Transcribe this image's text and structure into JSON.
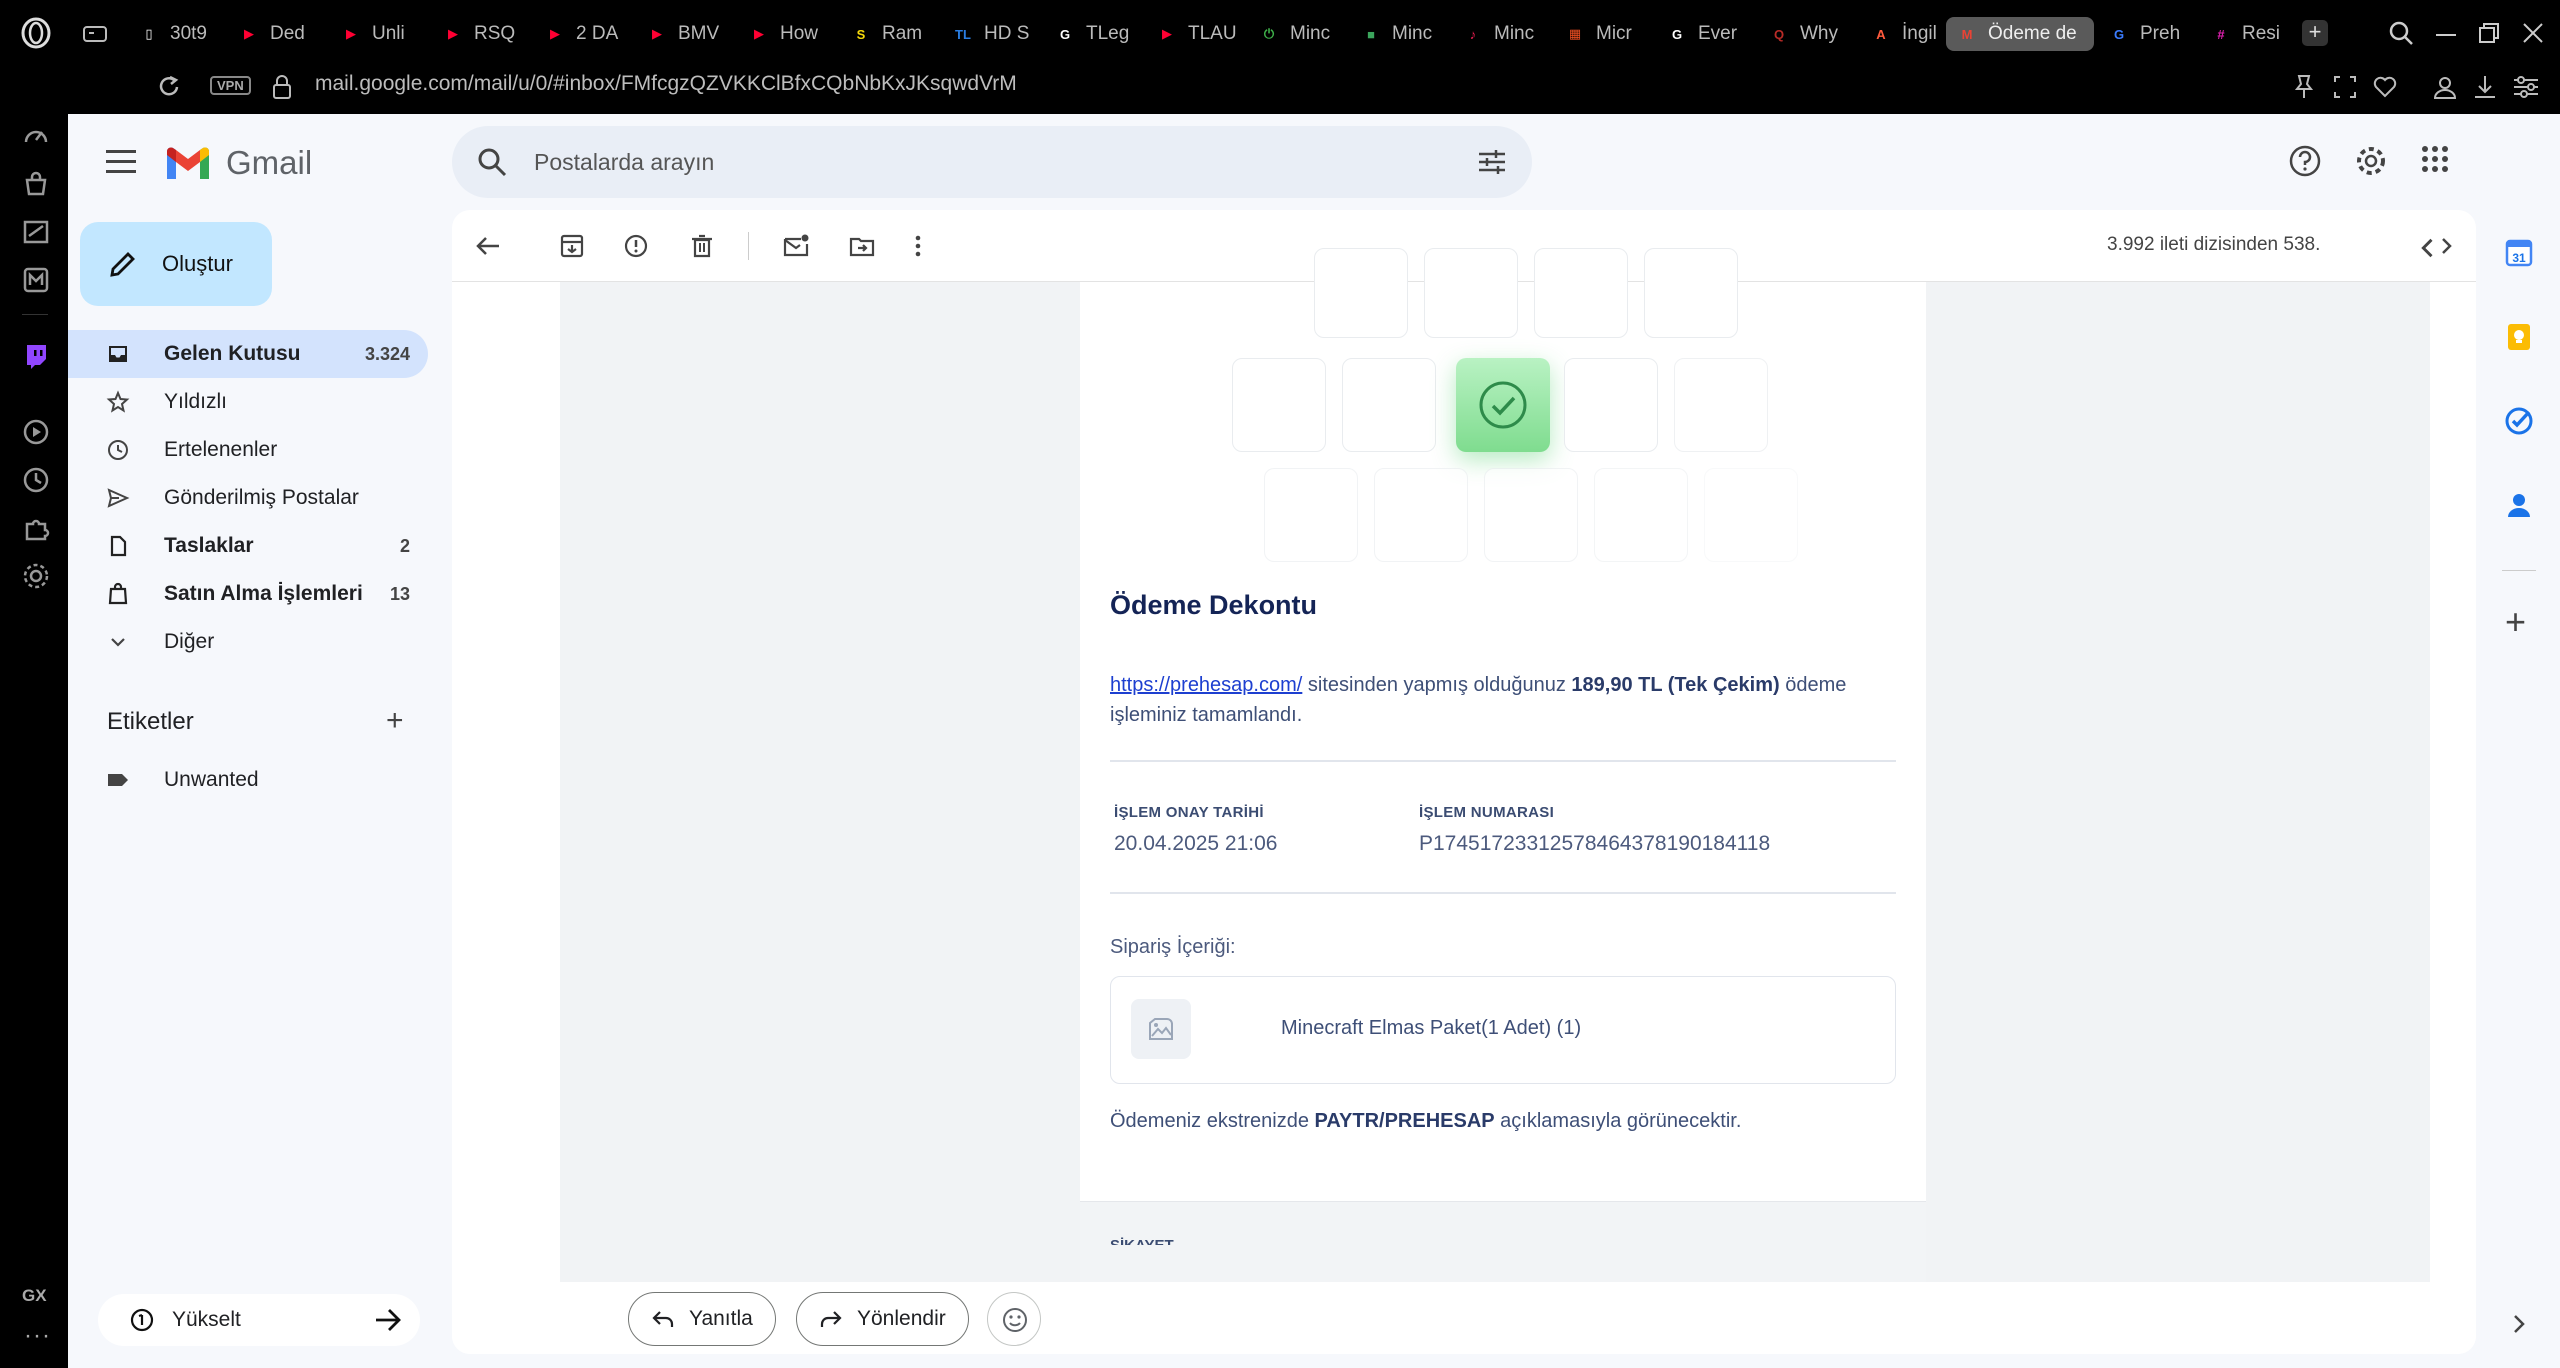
{
  "browser": {
    "tabs": [
      {
        "label": "30t9",
        "icon": "file-icon",
        "color": "#ffffff"
      },
      {
        "label": "Ded",
        "icon": "youtube-icon",
        "color": "#ff0033"
      },
      {
        "label": "Unli",
        "icon": "youtube-icon",
        "color": "#ff0033"
      },
      {
        "label": "RSQ",
        "icon": "youtube-icon",
        "color": "#ff0033"
      },
      {
        "label": "2 DA",
        "icon": "youtube-icon",
        "color": "#ff0033"
      },
      {
        "label": "BMV",
        "icon": "youtube-icon",
        "color": "#ff0033"
      },
      {
        "label": "How",
        "icon": "youtube-icon",
        "color": "#ff0033"
      },
      {
        "label": "Ram",
        "icon": "s-icon",
        "color": "#f5d90a"
      },
      {
        "label": "HD S",
        "icon": "tl-icon",
        "color": "#2a7de1"
      },
      {
        "label": "TLeg",
        "icon": "google-icon",
        "color": "#ffffff"
      },
      {
        "label": "TLAU",
        "icon": "youtube-icon",
        "color": "#ff0033"
      },
      {
        "label": "Minc",
        "icon": "power-icon",
        "color": "#3fb24a"
      },
      {
        "label": "Minc",
        "icon": "creeper-icon",
        "color": "#3ba55c"
      },
      {
        "label": "Minc",
        "icon": "tiktok-icon",
        "color": "#ee1d52"
      },
      {
        "label": "Micr",
        "icon": "microsoft-icon",
        "color": "#f25022"
      },
      {
        "label": "Ever",
        "icon": "google-icon",
        "color": "#ffffff"
      },
      {
        "label": "Why",
        "icon": "quora-icon",
        "color": "#b92b27"
      },
      {
        "label": "İngil",
        "icon": "translate-icon",
        "color": "#ff5a3c"
      },
      {
        "label": "Ödeme de",
        "icon": "gmail-icon",
        "color": "#ea4335"
      },
      {
        "label": "Preh",
        "icon": "prehesap-icon",
        "color": "#3b7cff"
      },
      {
        "label": "Resi",
        "icon": "hashtag-icon",
        "color": "#e020b0"
      }
    ],
    "url": "mail.google.com/mail/u/0/#inbox/FMfcgzQZVKKClBfxCQbNbKxJKsqwdVrM",
    "vpn_label": "VPN",
    "gx_label": "GX"
  },
  "gmail": {
    "logo_text": "Gmail",
    "search_placeholder": "Postalarda arayın",
    "compose_label": "Oluştur",
    "nav": [
      {
        "label": "Gelen Kutusu",
        "count": "3.324",
        "icon": "inbox-icon",
        "bold": true,
        "active": true
      },
      {
        "label": "Yıldızlı",
        "count": "",
        "icon": "star-icon",
        "bold": false,
        "active": false
      },
      {
        "label": "Ertelenenler",
        "count": "",
        "icon": "clock-icon",
        "bold": false,
        "active": false
      },
      {
        "label": "Gönderilmiş Postalar",
        "count": "",
        "icon": "send-icon",
        "bold": false,
        "active": false
      },
      {
        "label": "Taslaklar",
        "count": "2",
        "icon": "draft-icon",
        "bold": true,
        "active": false
      },
      {
        "label": "Satın Alma İşlemleri",
        "count": "13",
        "icon": "bag-icon",
        "bold": true,
        "active": false
      },
      {
        "label": "Diğer",
        "count": "",
        "icon": "chevron-down-icon",
        "bold": false,
        "active": false
      }
    ],
    "labels_title": "Etiketler",
    "labels": [
      {
        "label": "Unwanted",
        "icon": "label-icon"
      }
    ],
    "upgrade_label": "Yükselt",
    "page_info": "3.992 ileti dizisinden 538.",
    "reply_label": "Yanıtla",
    "forward_label": "Yönlendir"
  },
  "email": {
    "title": "Ödeme Dekontu",
    "link": "https://prehesap.com/",
    "text_1": " sitesinden yapmış olduğunuz ",
    "amount": "189,90 TL (Tek Çekim)",
    "text_2": " ödeme işleminiz tamamlandı.",
    "approval_date_label": "İŞLEM ONAY TARİHİ",
    "approval_date": "20.04.2025 21:06",
    "transaction_no_label": "İŞLEM NUMARASI",
    "transaction_no": "P1745172331257846437819018411​8",
    "order_label": "Sipariş İçeriği:",
    "order_item": "Minecraft Elmas Paket(1 Adet) (1)",
    "statement_text_1": "Ödemeniz ekstrenizde ",
    "statement_bold": "PAYTR/PREHESAP",
    "statement_text_2": " açıklamasıyla görünecektir.",
    "footer_label": "ŞİKAYET"
  }
}
